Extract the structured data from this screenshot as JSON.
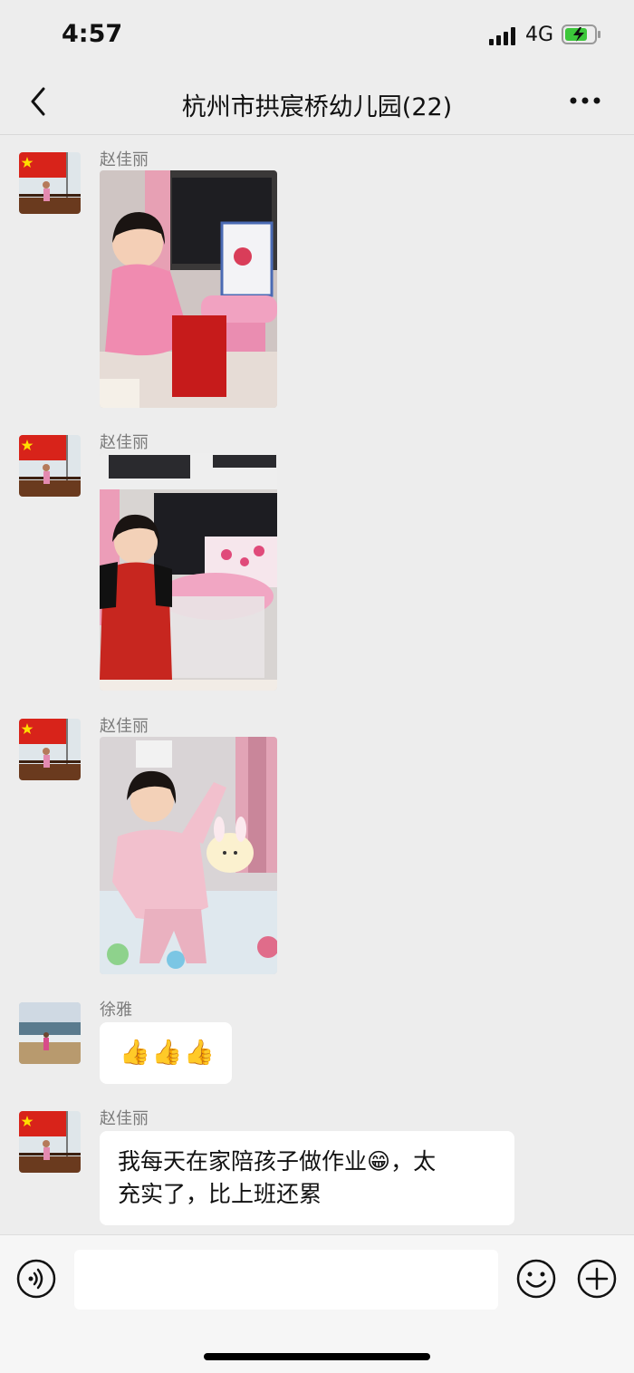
{
  "status_bar": {
    "time": "4:57",
    "network": "4G"
  },
  "header": {
    "title": "杭州市拱宸桥幼儿园(22)"
  },
  "messages": [
    {
      "sender": "赵佳丽",
      "type": "image"
    },
    {
      "sender": "赵佳丽",
      "type": "image"
    },
    {
      "sender": "赵佳丽",
      "type": "image"
    },
    {
      "sender": "徐雅",
      "type": "emoji",
      "text": "👍👍👍"
    },
    {
      "sender": "赵佳丽",
      "type": "text",
      "line1": "我每天在家陪孩子做作业😁，太",
      "line2": "充实了，比上班还累"
    }
  ],
  "colors": {
    "background": "#ededed",
    "bubble": "#ffffff",
    "sender": "#7b7b7b"
  }
}
